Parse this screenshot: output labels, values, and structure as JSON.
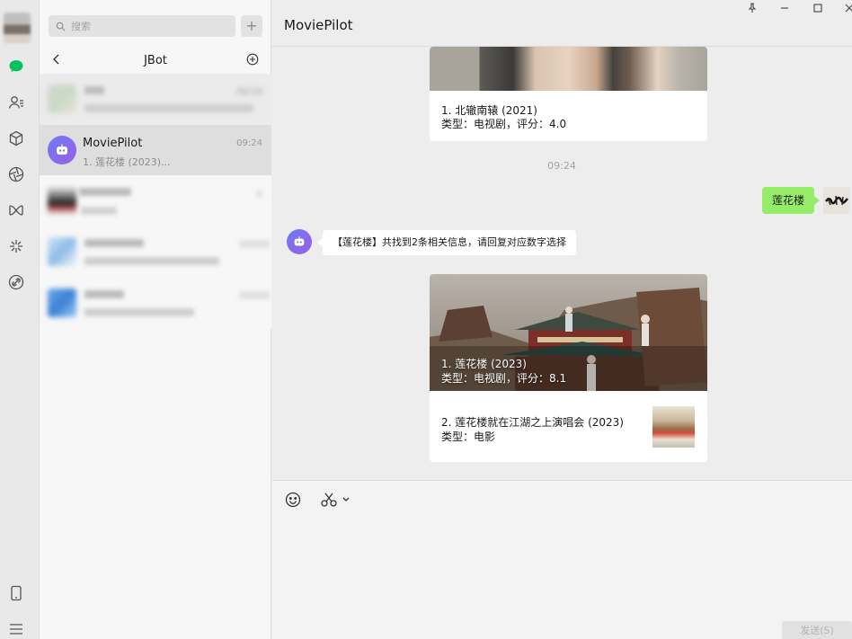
{
  "sidebar": {
    "icons": [
      "chat-icon",
      "contacts-icon",
      "favorites-icon",
      "moments-icon",
      "mini-programs-icon",
      "channels-icon",
      "search-network-icon",
      "phone-icon",
      "menu-icon"
    ]
  },
  "sessions": {
    "search_placeholder": "搜索",
    "add_label": "+",
    "group_title": "JBot",
    "items": [
      {
        "name": "",
        "preview": "",
        "time": "08/18",
        "blurred": true
      },
      {
        "name": "MoviePilot",
        "preview": "1. 莲花楼 (2023)...",
        "time": "09:24",
        "selected": true
      },
      {
        "name": "",
        "preview": "",
        "time": "a",
        "blurred": true
      },
      {
        "name": "",
        "preview": "",
        "time": "",
        "blurred": true
      },
      {
        "name": "",
        "preview": "",
        "time": "",
        "blurred": true
      }
    ]
  },
  "chat": {
    "title": "MoviePilot",
    "card1": {
      "line1": "1. 北辙南辕 (2021)",
      "line2": "类型：电视剧，评分：4.0"
    },
    "timestamp": "09:24",
    "my_message": "莲花楼",
    "bot_message": "【莲花楼】共找到2条相关信息，请回复对应数字选择",
    "card2": {
      "overlay1": "1. 莲花楼 (2023)",
      "overlay2": "类型：电视剧，评分：8.1",
      "row_line1": "2. 莲花楼就在江湖之上演唱会 (2023)",
      "row_line2": "类型：电影"
    },
    "send_label": "发送(S)"
  },
  "colors": {
    "accent_green": "#07c160",
    "my_bubble": "#95ec69",
    "bot_gradient": [
      "#6b7cf5",
      "#9b5de5"
    ]
  }
}
